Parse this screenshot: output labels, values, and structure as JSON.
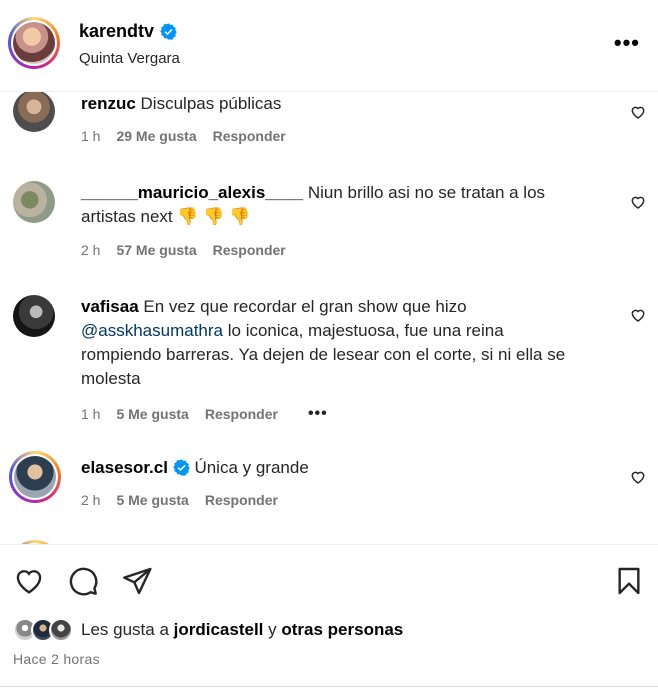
{
  "header": {
    "username": "karendtv",
    "location": "Quinta Vergara",
    "more_icon": "more-horizontal-icon"
  },
  "comments": [
    {
      "user": "renzuc",
      "text": "Disculpas públicas",
      "time": "1 h",
      "likes": "29 Me gusta",
      "reply": "Responder"
    },
    {
      "user": "______mauricio_alexis____",
      "text_line1": "Niun brillo asi no se tratan a los",
      "text_line2": "artistas next 👎 👎 👎",
      "time": "2 h",
      "likes": "57 Me gusta",
      "reply": "Responder"
    },
    {
      "user": "vafisaa",
      "text_line1": "En vez que recordar el gran show que hizo",
      "mention": "@asskhasumathra",
      "text_line2": "lo iconica, majestuosa, fue una reina",
      "text_line3": "rompiendo barreras. Ya dejen de lesear con el corte, si ni ella se",
      "text_line4": "molesta",
      "time": "1 h",
      "likes": "5 Me gusta",
      "reply": "Responder"
    },
    {
      "user": "elasesor.cl",
      "text": "Única y grande",
      "time": "2 h",
      "likes": "5 Me gusta",
      "reply": "Responder"
    }
  ],
  "footer": {
    "likes_prefix": "Les gusta a",
    "likes_user": "jordicastell",
    "likes_middle": "y",
    "likes_suffix": "otras personas",
    "time_ago": "Hace 2 horas"
  },
  "colors": {
    "verified": "#0095f6",
    "mention": "#00376b",
    "meta": "#737373"
  }
}
